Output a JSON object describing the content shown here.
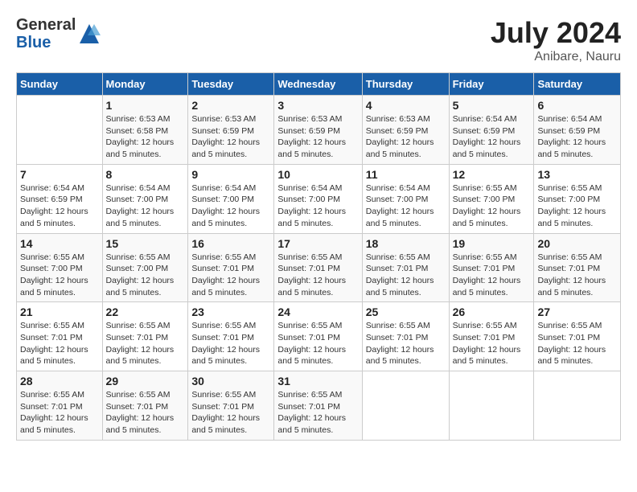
{
  "logo": {
    "general": "General",
    "blue": "Blue"
  },
  "title": {
    "month_year": "July 2024",
    "location": "Anibare, Nauru"
  },
  "days_of_week": [
    "Sunday",
    "Monday",
    "Tuesday",
    "Wednesday",
    "Thursday",
    "Friday",
    "Saturday"
  ],
  "weeks": [
    [
      {
        "day": "",
        "info": ""
      },
      {
        "day": "1",
        "info": "Sunrise: 6:53 AM\nSunset: 6:58 PM\nDaylight: 12 hours\nand 5 minutes."
      },
      {
        "day": "2",
        "info": "Sunrise: 6:53 AM\nSunset: 6:59 PM\nDaylight: 12 hours\nand 5 minutes."
      },
      {
        "day": "3",
        "info": "Sunrise: 6:53 AM\nSunset: 6:59 PM\nDaylight: 12 hours\nand 5 minutes."
      },
      {
        "day": "4",
        "info": "Sunrise: 6:53 AM\nSunset: 6:59 PM\nDaylight: 12 hours\nand 5 minutes."
      },
      {
        "day": "5",
        "info": "Sunrise: 6:54 AM\nSunset: 6:59 PM\nDaylight: 12 hours\nand 5 minutes."
      },
      {
        "day": "6",
        "info": "Sunrise: 6:54 AM\nSunset: 6:59 PM\nDaylight: 12 hours\nand 5 minutes."
      }
    ],
    [
      {
        "day": "7",
        "info": "Sunrise: 6:54 AM\nSunset: 6:59 PM\nDaylight: 12 hours\nand 5 minutes."
      },
      {
        "day": "8",
        "info": "Sunrise: 6:54 AM\nSunset: 7:00 PM\nDaylight: 12 hours\nand 5 minutes."
      },
      {
        "day": "9",
        "info": "Sunrise: 6:54 AM\nSunset: 7:00 PM\nDaylight: 12 hours\nand 5 minutes."
      },
      {
        "day": "10",
        "info": "Sunrise: 6:54 AM\nSunset: 7:00 PM\nDaylight: 12 hours\nand 5 minutes."
      },
      {
        "day": "11",
        "info": "Sunrise: 6:54 AM\nSunset: 7:00 PM\nDaylight: 12 hours\nand 5 minutes."
      },
      {
        "day": "12",
        "info": "Sunrise: 6:55 AM\nSunset: 7:00 PM\nDaylight: 12 hours\nand 5 minutes."
      },
      {
        "day": "13",
        "info": "Sunrise: 6:55 AM\nSunset: 7:00 PM\nDaylight: 12 hours\nand 5 minutes."
      }
    ],
    [
      {
        "day": "14",
        "info": "Sunrise: 6:55 AM\nSunset: 7:00 PM\nDaylight: 12 hours\nand 5 minutes."
      },
      {
        "day": "15",
        "info": "Sunrise: 6:55 AM\nSunset: 7:00 PM\nDaylight: 12 hours\nand 5 minutes."
      },
      {
        "day": "16",
        "info": "Sunrise: 6:55 AM\nSunset: 7:01 PM\nDaylight: 12 hours\nand 5 minutes."
      },
      {
        "day": "17",
        "info": "Sunrise: 6:55 AM\nSunset: 7:01 PM\nDaylight: 12 hours\nand 5 minutes."
      },
      {
        "day": "18",
        "info": "Sunrise: 6:55 AM\nSunset: 7:01 PM\nDaylight: 12 hours\nand 5 minutes."
      },
      {
        "day": "19",
        "info": "Sunrise: 6:55 AM\nSunset: 7:01 PM\nDaylight: 12 hours\nand 5 minutes."
      },
      {
        "day": "20",
        "info": "Sunrise: 6:55 AM\nSunset: 7:01 PM\nDaylight: 12 hours\nand 5 minutes."
      }
    ],
    [
      {
        "day": "21",
        "info": "Sunrise: 6:55 AM\nSunset: 7:01 PM\nDaylight: 12 hours\nand 5 minutes."
      },
      {
        "day": "22",
        "info": "Sunrise: 6:55 AM\nSunset: 7:01 PM\nDaylight: 12 hours\nand 5 minutes."
      },
      {
        "day": "23",
        "info": "Sunrise: 6:55 AM\nSunset: 7:01 PM\nDaylight: 12 hours\nand 5 minutes."
      },
      {
        "day": "24",
        "info": "Sunrise: 6:55 AM\nSunset: 7:01 PM\nDaylight: 12 hours\nand 5 minutes."
      },
      {
        "day": "25",
        "info": "Sunrise: 6:55 AM\nSunset: 7:01 PM\nDaylight: 12 hours\nand 5 minutes."
      },
      {
        "day": "26",
        "info": "Sunrise: 6:55 AM\nSunset: 7:01 PM\nDaylight: 12 hours\nand 5 minutes."
      },
      {
        "day": "27",
        "info": "Sunrise: 6:55 AM\nSunset: 7:01 PM\nDaylight: 12 hours\nand 5 minutes."
      }
    ],
    [
      {
        "day": "28",
        "info": "Sunrise: 6:55 AM\nSunset: 7:01 PM\nDaylight: 12 hours\nand 5 minutes."
      },
      {
        "day": "29",
        "info": "Sunrise: 6:55 AM\nSunset: 7:01 PM\nDaylight: 12 hours\nand 5 minutes."
      },
      {
        "day": "30",
        "info": "Sunrise: 6:55 AM\nSunset: 7:01 PM\nDaylight: 12 hours\nand 5 minutes."
      },
      {
        "day": "31",
        "info": "Sunrise: 6:55 AM\nSunset: 7:01 PM\nDaylight: 12 hours\nand 5 minutes."
      },
      {
        "day": "",
        "info": ""
      },
      {
        "day": "",
        "info": ""
      },
      {
        "day": "",
        "info": ""
      }
    ]
  ]
}
